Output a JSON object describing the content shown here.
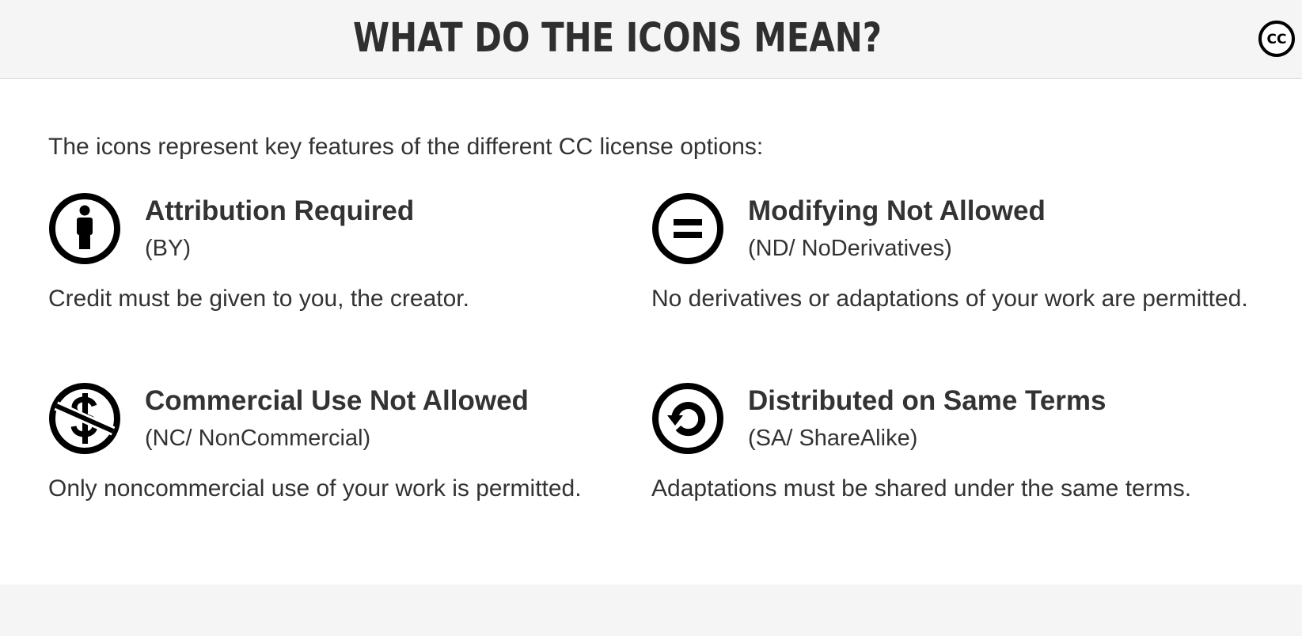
{
  "header": {
    "title": "WHAT DO THE ICONS MEAN?",
    "logo_icon": "cc-logo-icon",
    "logo_text": "CC"
  },
  "intro": "The icons represent key features of the different CC license options:",
  "features": [
    {
      "icon": "attribution-person-icon",
      "title": "Attribution Required",
      "code": "(BY)",
      "description": "Credit must be given to you, the creator."
    },
    {
      "icon": "equals-icon",
      "title": "Modifying Not Allowed",
      "code": "(ND/ NoDerivatives)",
      "description": "No derivatives or adaptations of your work are permitted."
    },
    {
      "icon": "no-dollar-icon",
      "title": "Commercial Use Not Allowed",
      "code": "(NC/ NonCommercial)",
      "description": "Only noncommercial use of your work is permitted."
    },
    {
      "icon": "share-alike-icon",
      "title": "Distributed on Same Terms",
      "code": "(SA/ ShareAlike)",
      "description": "Adaptations must be shared under the same terms."
    }
  ],
  "colors": {
    "text": "#333333",
    "header_bg": "#f5f5f5",
    "content_bg": "#ffffff",
    "icon": "#000000"
  }
}
